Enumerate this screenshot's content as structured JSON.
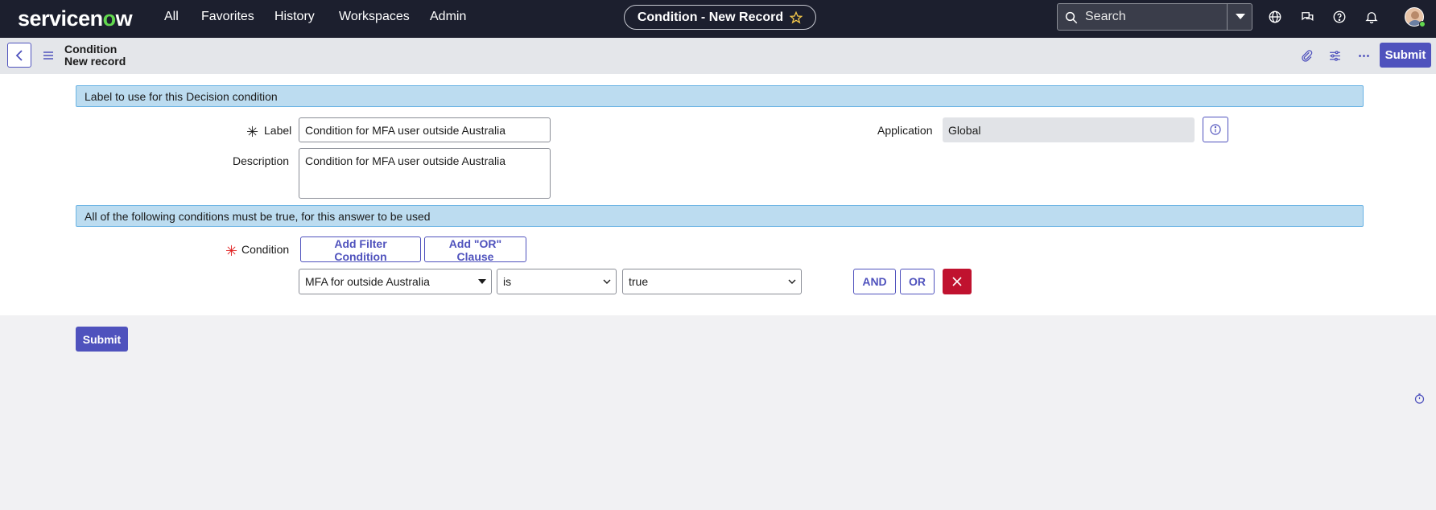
{
  "topbar": {
    "logo_text": "servicenow",
    "nav": [
      "All",
      "Favorites",
      "History",
      "Workspaces",
      "Admin"
    ],
    "record_title": "Condition - New Record",
    "search_placeholder": "Search"
  },
  "subheader": {
    "title": "Condition",
    "subtitle": "New record",
    "submit_label": "Submit"
  },
  "form": {
    "section1_title": "Label to use for this Decision condition",
    "label_field": {
      "label": "Label",
      "value": "Condition for MFA user outside Australia"
    },
    "description_field": {
      "label": "Description",
      "value": "Condition for MFA user outside Australia"
    },
    "application_field": {
      "label": "Application",
      "value": "Global"
    },
    "section2_title": "All of the following conditions must be true, for this answer to be used",
    "condition_label": "Condition",
    "add_filter_label": "Add Filter Condition",
    "add_or_label": "Add \"OR\" Clause",
    "condition_row": {
      "field": "MFA for outside Australia",
      "operator": "is",
      "value": "true",
      "and_label": "AND",
      "or_label": "OR"
    },
    "submit_label": "Submit"
  },
  "colors": {
    "topbar_bg": "#1c1f2e",
    "brand_green": "#62d84e",
    "primary": "#4f52bd",
    "section_bg": "#bcdcf0",
    "delete_red": "#c0122f",
    "required_red": "#e02020"
  }
}
